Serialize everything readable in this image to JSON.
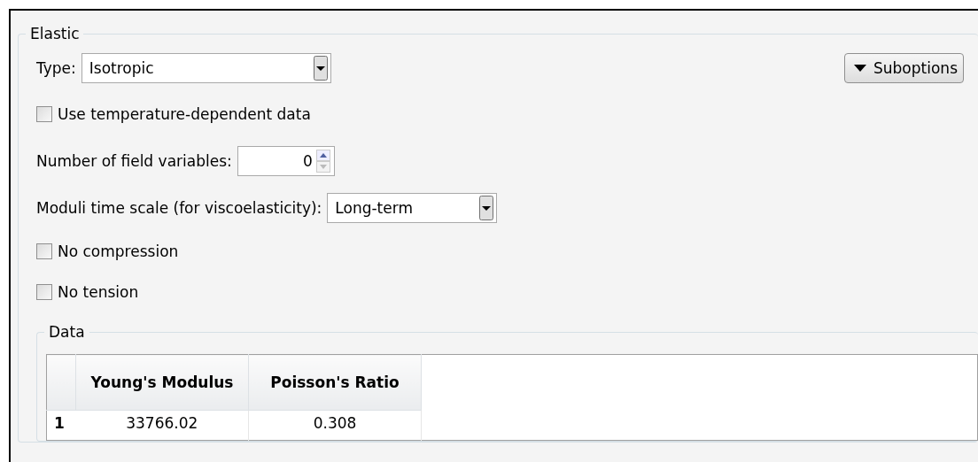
{
  "group": {
    "title": "Elastic"
  },
  "type_field": {
    "label": "Type:",
    "value": "Isotropic"
  },
  "suboptions_button": {
    "label": "Suboptions"
  },
  "rows": [
    {
      "kind": "checkbox",
      "label": "Use temperature-dependent data",
      "checked": false
    },
    {
      "kind": "spinner",
      "label": "Number of field variables:",
      "value": "0"
    },
    {
      "kind": "combo",
      "label": "Moduli time scale (for viscoelasticity):",
      "value": "Long-term"
    },
    {
      "kind": "checkbox",
      "label": "No compression",
      "checked": false
    },
    {
      "kind": "checkbox",
      "label": "No tension",
      "checked": false
    }
  ],
  "data": {
    "title": "Data",
    "columns": [
      "Young's Modulus",
      "Poisson's Ratio"
    ],
    "rows": [
      {
        "index": "1",
        "cells": [
          "33766.02",
          "0.308"
        ]
      }
    ]
  }
}
